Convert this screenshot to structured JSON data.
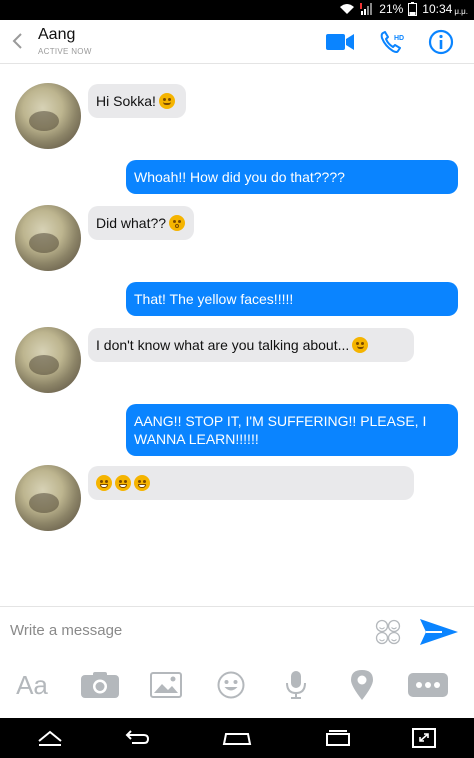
{
  "status_bar": {
    "battery": "21%",
    "time": "10:34",
    "ampm": "μ.μ."
  },
  "header": {
    "contact_name": "Aang",
    "contact_status": "ACTIVE NOW"
  },
  "messages": [
    {
      "direction": "in",
      "text": "Hi Sokka!",
      "emoji": [
        "smile"
      ]
    },
    {
      "direction": "out",
      "text": "Whoah!! How did you do that????"
    },
    {
      "direction": "in",
      "text": "Did what??",
      "emoji": [
        "surprised"
      ]
    },
    {
      "direction": "out",
      "text": "That! The yellow faces!!!!!"
    },
    {
      "direction": "in",
      "text": "I don't know what are you talking about...",
      "emoji": [
        "smirk"
      ]
    },
    {
      "direction": "out",
      "text": "AANG!! STOP IT, I'M SUFFERING!! PLEASE, I WANNA LEARN!!!!!!"
    },
    {
      "direction": "in",
      "text": "",
      "emoji": [
        "grin",
        "grin",
        "grin"
      ]
    }
  ],
  "composer": {
    "placeholder": "Write a message"
  },
  "toolbar": {
    "text_tool_label": "Aa"
  },
  "colors": {
    "accent": "#0a84ff",
    "incoming_bubble": "#e9e9eb",
    "icon_gray": "#b4b8bc"
  },
  "icons": {
    "header": [
      "back-chevron-icon",
      "video-call-icon",
      "hd-call-icon",
      "info-icon"
    ],
    "toolbar": [
      "text-format-icon",
      "camera-icon",
      "gallery-icon",
      "emoji-icon",
      "microphone-icon",
      "location-icon",
      "more-icon"
    ],
    "nav": [
      "home-icon",
      "back-icon",
      "recents-icon",
      "apps-icon",
      "screen-switch-icon"
    ]
  }
}
